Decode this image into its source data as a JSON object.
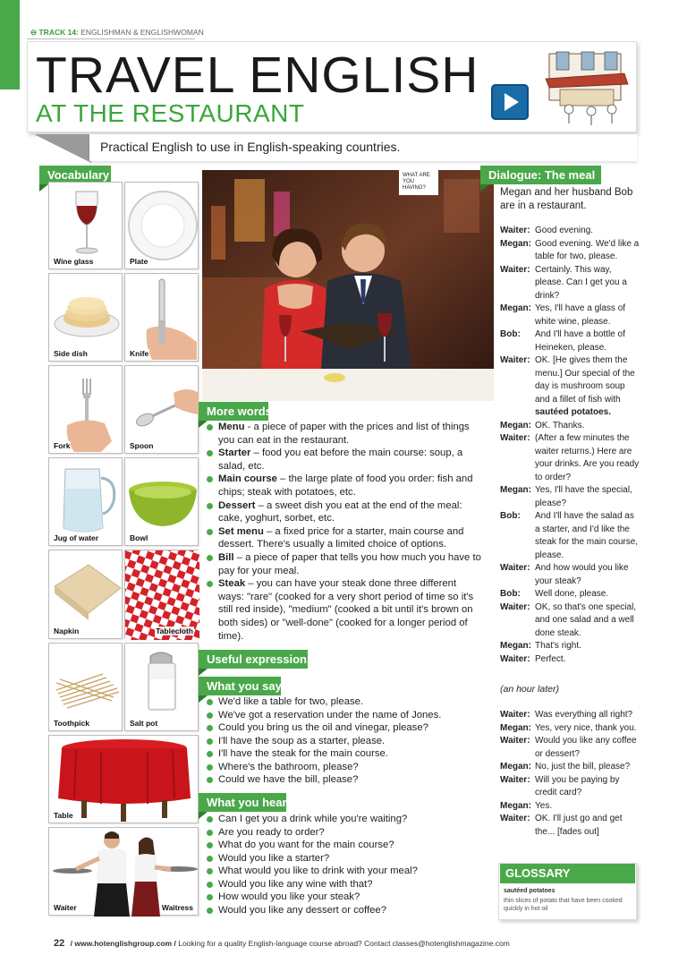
{
  "header": {
    "track_number": "TRACK 14:",
    "track_topic": "ENGLISHMAN & ENGLISHWOMAN",
    "title": "TRAVEL ENGLISH",
    "section": "AT THE RESTAURANT",
    "subtitle": "Practical English to use in English-speaking countries."
  },
  "colors": {
    "accent_green": "#4aa84a",
    "play_blue": "#1a6ca8"
  },
  "icons": [
    "play-icon",
    "bullet-icon"
  ],
  "vocabulary": {
    "heading": "Vocabulary",
    "items": [
      {
        "label": "Wine glass"
      },
      {
        "label": "Plate"
      },
      {
        "label": "Side dish"
      },
      {
        "label": "Knife"
      },
      {
        "label": "Fork"
      },
      {
        "label": "Spoon"
      },
      {
        "label": "Jug of water"
      },
      {
        "label": "Bowl"
      },
      {
        "label": "Napkin"
      },
      {
        "label": "Tablecloth"
      },
      {
        "label": "Toothpick"
      },
      {
        "label": "Salt pot"
      },
      {
        "label": "Table"
      },
      {
        "label": "Waiter"
      },
      {
        "label": "Waitress"
      }
    ]
  },
  "photo_caption": "WHAT ARE YOU HAVING?",
  "more_words": {
    "heading": "More words",
    "items": [
      {
        "term": "Menu",
        "def": " - a piece of paper with the prices and list of things you can eat in the restaurant."
      },
      {
        "term": "Starter",
        "def": " – food you eat before the main course: soup, a salad, etc."
      },
      {
        "term": "Main course",
        "def": " – the large plate of food you order: fish and chips; steak with potatoes, etc."
      },
      {
        "term": "Dessert",
        "def": " – a sweet dish you eat at the end of the meal: cake, yoghurt, sorbet, etc."
      },
      {
        "term": "Set menu",
        "def": " – a fixed price for a starter, main course and dessert. There's usually a limited choice of options."
      },
      {
        "term": "Bill",
        "def": " – a piece of paper that tells you how much you have to pay for your meal."
      },
      {
        "term": "Steak",
        "def": " – you can have your steak done three different ways: \"rare\" (cooked for a very short period of time so it's still red inside), \"medium\" (cooked a bit until it's brown on both sides) or \"well-done\" (cooked for a longer period of time)."
      }
    ]
  },
  "useful_expressions": {
    "heading": "Useful expressions",
    "you_say": {
      "heading": "What you say",
      "items": [
        "We'd like a table for two, please.",
        "We've got a reservation under the name of Jones.",
        "Could you bring us the oil and vinegar, please?",
        "I'll have the soup as a starter, please.",
        "I'll have the steak for the main course.",
        "Where's the bathroom, please?",
        "Could we have the bill, please?"
      ]
    },
    "you_hear": {
      "heading": "What you hear",
      "items": [
        "Can I get you a drink while you're waiting?",
        "Are you ready to order?",
        "What do you want for the main course?",
        "Would you like a starter?",
        "What would you like to drink with your meal?",
        "Would you like any wine with that?",
        "How would you like your steak?",
        "Would you like any dessert or coffee?"
      ]
    }
  },
  "dialogue": {
    "heading": "Dialogue: The meal",
    "intro": "Megan and her husband Bob are in a restaurant.",
    "lines_part1": [
      {
        "speaker": "Waiter:",
        "text": "Good evening."
      },
      {
        "speaker": "Megan:",
        "text": "Good evening. We'd like a table for two, please."
      },
      {
        "speaker": "Waiter:",
        "text": "Certainly. This way, please. Can I get you a drink?"
      },
      {
        "speaker": "Megan:",
        "text": "Yes, I'll have a glass of white wine, please."
      },
      {
        "speaker": "Bob:",
        "text": "And I'll have a bottle of Heineken, please."
      },
      {
        "speaker": "Waiter:",
        "text": "OK. [He gives them the menu.] Our special of the day is mushroom soup and a fillet of fish with",
        "bold_tail": "sautéed potatoes."
      },
      {
        "speaker": "Megan:",
        "text": "OK. Thanks."
      },
      {
        "speaker": "Waiter:",
        "text": "(After a few minutes the waiter returns.) Here are your drinks. Are you ready to order?"
      },
      {
        "speaker": "Megan:",
        "text": "Yes, I'll have the special, please?"
      },
      {
        "speaker": "Bob:",
        "text": "And I'll have the salad as a starter, and I'd like the steak for the main course, please."
      },
      {
        "speaker": "Waiter:",
        "text": "And how would you like your steak?"
      },
      {
        "speaker": "Bob:",
        "text": "Well done, please."
      },
      {
        "speaker": "Waiter:",
        "text": "OK, so that's one special, and one salad and a well done steak."
      },
      {
        "speaker": "Megan:",
        "text": "That's right."
      },
      {
        "speaker": "Waiter:",
        "text": "Perfect."
      }
    ],
    "later": "(an hour later)",
    "lines_part2": [
      {
        "speaker": "Waiter:",
        "text": "Was everything all right?"
      },
      {
        "speaker": "Megan:",
        "text": "Yes, very nice, thank you."
      },
      {
        "speaker": "Waiter:",
        "text": "Would you like any coffee or dessert?"
      },
      {
        "speaker": "Megan:",
        "text": "No, just the bill, please?"
      },
      {
        "speaker": "Waiter:",
        "text": "Will you be paying by credit card?"
      },
      {
        "speaker": "Megan:",
        "text": "Yes."
      },
      {
        "speaker": "Waiter:",
        "text": "OK. I'll just go and get the... [fades out]"
      }
    ]
  },
  "glossary": {
    "heading": "GLOSSARY",
    "term": "sautéed potatoes",
    "def": "thin slices of potato that have been cooked quickly in hot oil"
  },
  "footer": {
    "page": "22",
    "url": "/ www.hotenglishgroup.com /",
    "text": "Looking for a quality English-language course abroad? Contact classes@hotenglishmagazine.com"
  }
}
